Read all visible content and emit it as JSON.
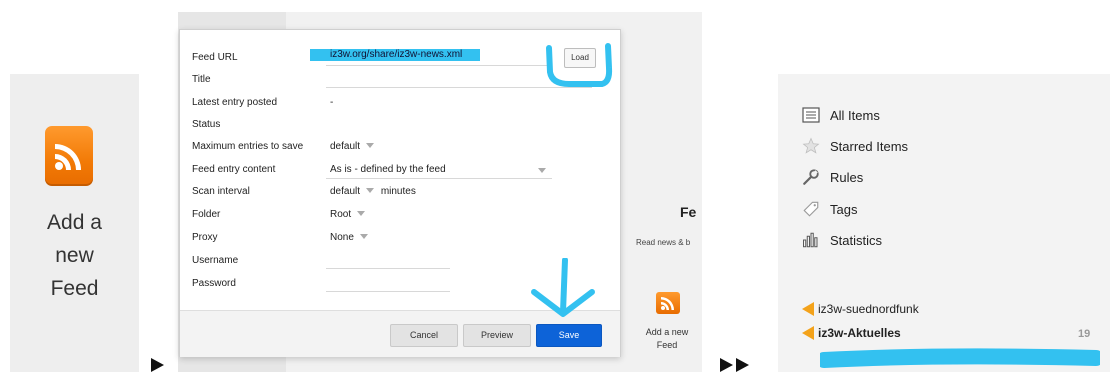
{
  "step_arrows": [
    "►",
    "►►"
  ],
  "tile": {
    "icon": "rss-icon",
    "label_lines": [
      "Add a",
      "new",
      "Feed"
    ]
  },
  "dialog": {
    "fields": [
      {
        "label": "Feed URL",
        "value": "iz3w.org/share/iz3w-news.xml"
      },
      {
        "label": "Title",
        "value": ""
      },
      {
        "label": "Latest entry posted",
        "value": "-"
      },
      {
        "label": "Status",
        "value": ""
      },
      {
        "label": "Maximum entries to save",
        "value": "default"
      },
      {
        "label": "Feed entry content",
        "value": "As is - defined by the feed"
      },
      {
        "label": "Scan interval",
        "value": "default",
        "suffix": "minutes"
      },
      {
        "label": "Folder",
        "value": "Root"
      },
      {
        "label": "Proxy",
        "value": "None"
      },
      {
        "label": "Username",
        "value": ""
      },
      {
        "label": "Password",
        "value": ""
      }
    ],
    "load_label": "Load",
    "cancel_label": "Cancel",
    "preview_label": "Preview",
    "save_label": "Save",
    "highlight_color": "#33c1f0",
    "save_color": "#0d63d8"
  },
  "background_page": {
    "title": "Fe",
    "subtitle": "Read news & b",
    "add_label_lines": [
      "Add a new",
      "Feed"
    ]
  },
  "sidebar": {
    "nav": [
      {
        "label": "All Items",
        "icon": "list-icon"
      },
      {
        "label": "Starred Items",
        "icon": "star-icon"
      },
      {
        "label": "Rules",
        "icon": "wrench-icon"
      },
      {
        "label": "Tags",
        "icon": "tag-icon"
      },
      {
        "label": "Statistics",
        "icon": "bar-chart-icon"
      }
    ],
    "feeds": [
      {
        "label": "iz3w-suednordfunk",
        "bold": false
      },
      {
        "label": "iz3w-Aktuelles",
        "bold": true,
        "count": "19"
      }
    ],
    "feed_icon_color": "#f3a21a"
  }
}
